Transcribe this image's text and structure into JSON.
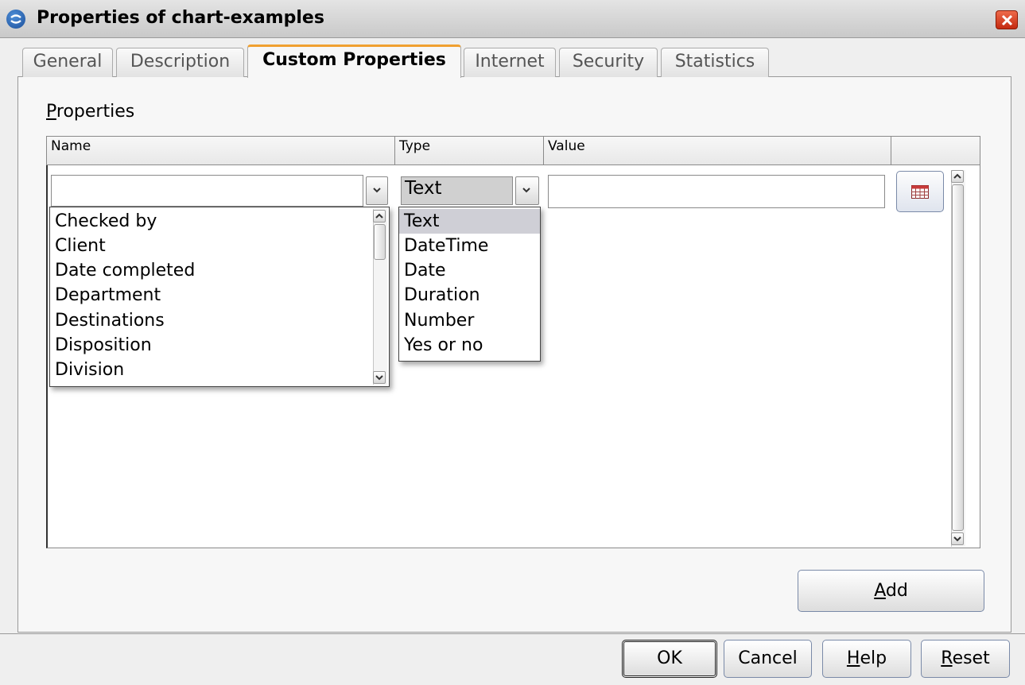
{
  "window": {
    "title": "Properties of chart-examples"
  },
  "tabs": [
    {
      "label": "General"
    },
    {
      "label": "Description"
    },
    {
      "label": "Custom Properties"
    },
    {
      "label": "Internet"
    },
    {
      "label": "Security"
    },
    {
      "label": "Statistics"
    }
  ],
  "active_tab": "Custom Properties",
  "properties": {
    "section_label_first": "P",
    "section_label_rest": "roperties",
    "columns": {
      "name": "Name",
      "type": "Type",
      "value": "Value"
    },
    "row": {
      "name_value": "",
      "type_value": "Text",
      "value_value": ""
    },
    "name_options": [
      "Checked by",
      "Client",
      "Date completed",
      "Department",
      "Destinations",
      "Disposition",
      "Division"
    ],
    "type_options": [
      "Text",
      "DateTime",
      "Date",
      "Duration",
      "Number",
      "Yes or no"
    ],
    "type_selected": "Text"
  },
  "buttons": {
    "add": {
      "mnemonic": "A",
      "rest": "dd"
    },
    "ok": {
      "label": "OK"
    },
    "cancel": {
      "label": "Cancel"
    },
    "help": {
      "mnemonic": "H",
      "rest": "elp"
    },
    "reset": {
      "mnemonic": "R",
      "rest": "eset"
    }
  },
  "icons": {
    "app": "app-icon",
    "close": "close-icon",
    "dropdown": "chevron-down-icon",
    "value_editor": "calendar-grid-icon"
  },
  "colors": {
    "active_tab_accent": "#f0a030",
    "close_button": "#d8401e",
    "selected_item": "#cfcfd6"
  }
}
